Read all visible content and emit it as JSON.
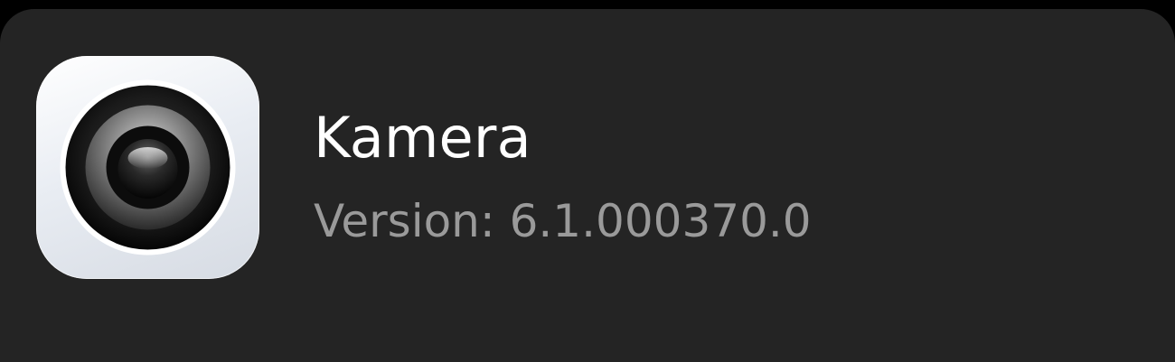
{
  "app": {
    "name": "Kamera",
    "version_text": "Version: 6.1.000370.0",
    "icon": "camera-lens-icon"
  },
  "colors": {
    "window_background": "#000000",
    "card_background": "#242424",
    "title_text": "#ffffff",
    "secondary_text": "#9a9a9a"
  }
}
